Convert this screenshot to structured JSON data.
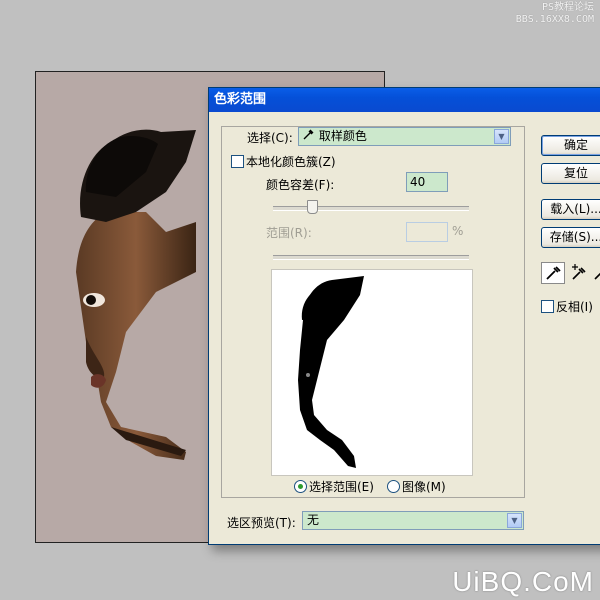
{
  "watermark": {
    "top_line1": "PS教程论坛",
    "top_line2": "BBS.16XX8.COM",
    "bottom": "UiBQ.CoM"
  },
  "dialog": {
    "title": "色彩范围",
    "select_label": "选择(C):",
    "select_value": "取样颜色",
    "localized_clusters_label": "本地化颜色簇(Z)",
    "localized_clusters_checked": false,
    "fuzziness_label": "颜色容差(F):",
    "fuzziness_value": "40",
    "fuzziness_slider_fraction": 0.2,
    "range_label": "范围(R):",
    "range_value": "",
    "range_unit": "%",
    "radio_selection_label": "选择范围(E)",
    "radio_image_label": "图像(M)",
    "radio_selected": "selection",
    "preview_label": "选区预览(T):",
    "preview_value": "无",
    "buttons": {
      "ok": "确定",
      "reset": "复位",
      "load": "载入(L)...",
      "save": "存储(S)..."
    },
    "invert_label": "反相(I)",
    "invert_checked": false
  },
  "colors": {
    "titlebar": "#0a5ee8",
    "select_bg": "#cce8cc",
    "canvas_bg": "#b7a9a6"
  }
}
